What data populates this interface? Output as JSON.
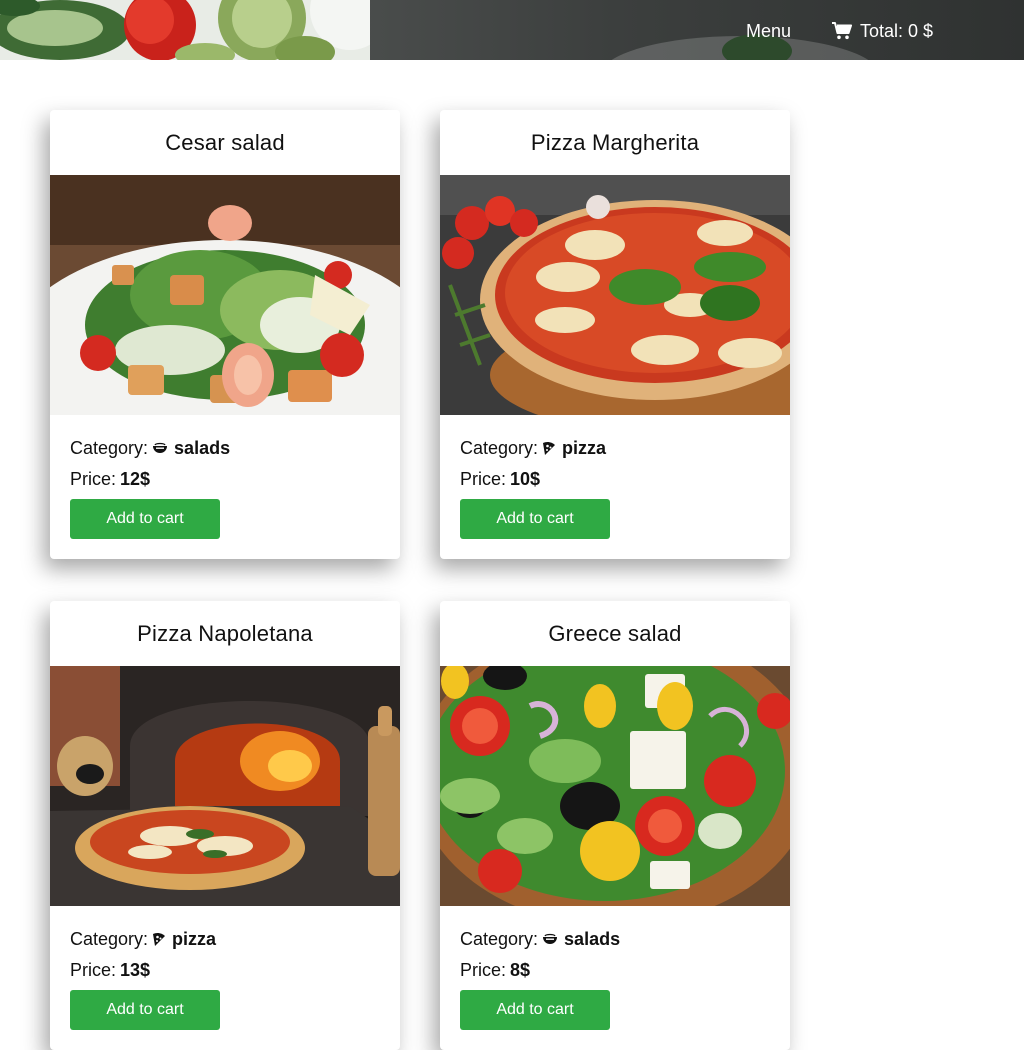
{
  "header": {
    "menu_label": "Menu",
    "cart_label": "Total: 0 $"
  },
  "cards": [
    {
      "title": "Cesar salad",
      "category_label": "Category:",
      "category": "salads",
      "category_icon": "bowl-icon",
      "price_label": "Price:",
      "price": "12$",
      "button_label": "Add to cart",
      "image": "cesar-salad-photo"
    },
    {
      "title": "Pizza Margherita",
      "category_label": "Category:",
      "category": "pizza",
      "category_icon": "pizza-slice-icon",
      "price_label": "Price:",
      "price": "10$",
      "button_label": "Add to cart",
      "image": "pizza-margherita-photo"
    },
    {
      "title": "Pizza Napoletana",
      "category_label": "Category:",
      "category": "pizza",
      "category_icon": "pizza-slice-icon",
      "price_label": "Price:",
      "price": "13$",
      "button_label": "Add to cart",
      "image": "pizza-napoletana-photo"
    },
    {
      "title": "Greece salad",
      "category_label": "Category:",
      "category": "salads",
      "category_icon": "bowl-icon",
      "price_label": "Price:",
      "price": "8$",
      "button_label": "Add to cart",
      "image": "greece-salad-photo"
    }
  ],
  "colors": {
    "button": "#2faa44",
    "header_bg": "#3c3f3e"
  }
}
